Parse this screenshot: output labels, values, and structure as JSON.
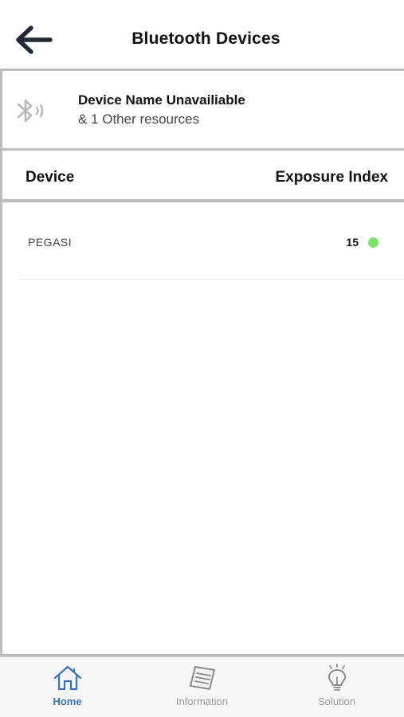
{
  "header": {
    "title": "Bluetooth Devices"
  },
  "summary": {
    "name": "Device Name Unavailiable",
    "subtitle": "& 1 Other resources"
  },
  "table": {
    "col_device": "Device",
    "col_exposure": "Exposure Index",
    "rows": [
      {
        "device": "PEGASI",
        "exposure": "15",
        "status_color": "#7ee36a"
      }
    ]
  },
  "tabs": [
    {
      "label": "Home",
      "icon": "home-icon",
      "active": true
    },
    {
      "label": "Information",
      "icon": "document-icon",
      "active": false
    },
    {
      "label": "Solution",
      "icon": "lightbulb-icon",
      "active": false
    }
  ],
  "colors": {
    "accent": "#3a73b8",
    "divider": "#bdbdbd",
    "status_ok": "#7ee36a"
  }
}
